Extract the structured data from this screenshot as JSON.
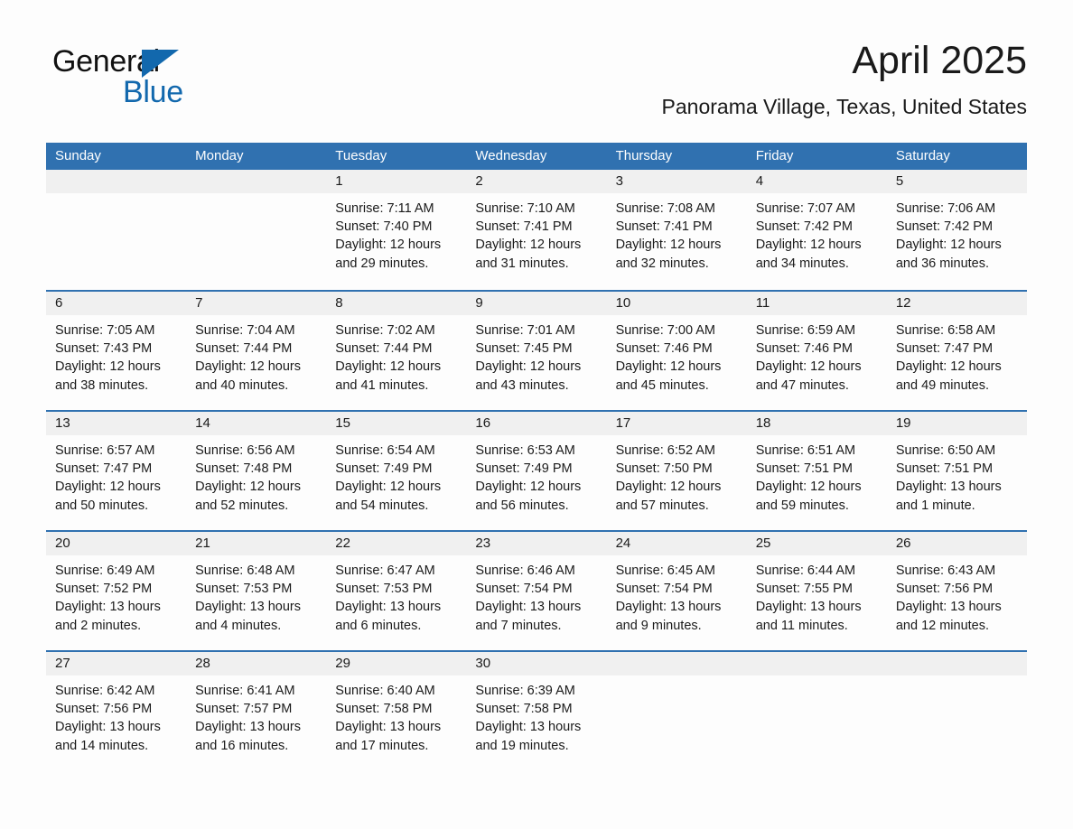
{
  "logo": {
    "word1": "General",
    "word2": "Blue",
    "triangle_color": "#1268ad"
  },
  "header": {
    "month_title": "April 2025",
    "location": "Panorama Village, Texas, United States"
  },
  "theme": {
    "header_blue": "#3071b0",
    "day_band_gray": "#f0f0f0",
    "page_background": "#fdfdfd",
    "text_color": "#1a1a1a"
  },
  "weekdays": [
    "Sunday",
    "Monday",
    "Tuesday",
    "Wednesday",
    "Thursday",
    "Friday",
    "Saturday"
  ],
  "weeks": [
    [
      {
        "day": "",
        "sunrise": "",
        "sunset": "",
        "daylight": "",
        "empty": true
      },
      {
        "day": "",
        "sunrise": "",
        "sunset": "",
        "daylight": "",
        "empty": true
      },
      {
        "day": "1",
        "sunrise": "Sunrise: 7:11 AM",
        "sunset": "Sunset: 7:40 PM",
        "daylight": "Daylight: 12 hours and 29 minutes."
      },
      {
        "day": "2",
        "sunrise": "Sunrise: 7:10 AM",
        "sunset": "Sunset: 7:41 PM",
        "daylight": "Daylight: 12 hours and 31 minutes."
      },
      {
        "day": "3",
        "sunrise": "Sunrise: 7:08 AM",
        "sunset": "Sunset: 7:41 PM",
        "daylight": "Daylight: 12 hours and 32 minutes."
      },
      {
        "day": "4",
        "sunrise": "Sunrise: 7:07 AM",
        "sunset": "Sunset: 7:42 PM",
        "daylight": "Daylight: 12 hours and 34 minutes."
      },
      {
        "day": "5",
        "sunrise": "Sunrise: 7:06 AM",
        "sunset": "Sunset: 7:42 PM",
        "daylight": "Daylight: 12 hours and 36 minutes."
      }
    ],
    [
      {
        "day": "6",
        "sunrise": "Sunrise: 7:05 AM",
        "sunset": "Sunset: 7:43 PM",
        "daylight": "Daylight: 12 hours and 38 minutes."
      },
      {
        "day": "7",
        "sunrise": "Sunrise: 7:04 AM",
        "sunset": "Sunset: 7:44 PM",
        "daylight": "Daylight: 12 hours and 40 minutes."
      },
      {
        "day": "8",
        "sunrise": "Sunrise: 7:02 AM",
        "sunset": "Sunset: 7:44 PM",
        "daylight": "Daylight: 12 hours and 41 minutes."
      },
      {
        "day": "9",
        "sunrise": "Sunrise: 7:01 AM",
        "sunset": "Sunset: 7:45 PM",
        "daylight": "Daylight: 12 hours and 43 minutes."
      },
      {
        "day": "10",
        "sunrise": "Sunrise: 7:00 AM",
        "sunset": "Sunset: 7:46 PM",
        "daylight": "Daylight: 12 hours and 45 minutes."
      },
      {
        "day": "11",
        "sunrise": "Sunrise: 6:59 AM",
        "sunset": "Sunset: 7:46 PM",
        "daylight": "Daylight: 12 hours and 47 minutes."
      },
      {
        "day": "12",
        "sunrise": "Sunrise: 6:58 AM",
        "sunset": "Sunset: 7:47 PM",
        "daylight": "Daylight: 12 hours and 49 minutes."
      }
    ],
    [
      {
        "day": "13",
        "sunrise": "Sunrise: 6:57 AM",
        "sunset": "Sunset: 7:47 PM",
        "daylight": "Daylight: 12 hours and 50 minutes."
      },
      {
        "day": "14",
        "sunrise": "Sunrise: 6:56 AM",
        "sunset": "Sunset: 7:48 PM",
        "daylight": "Daylight: 12 hours and 52 minutes."
      },
      {
        "day": "15",
        "sunrise": "Sunrise: 6:54 AM",
        "sunset": "Sunset: 7:49 PM",
        "daylight": "Daylight: 12 hours and 54 minutes."
      },
      {
        "day": "16",
        "sunrise": "Sunrise: 6:53 AM",
        "sunset": "Sunset: 7:49 PM",
        "daylight": "Daylight: 12 hours and 56 minutes."
      },
      {
        "day": "17",
        "sunrise": "Sunrise: 6:52 AM",
        "sunset": "Sunset: 7:50 PM",
        "daylight": "Daylight: 12 hours and 57 minutes."
      },
      {
        "day": "18",
        "sunrise": "Sunrise: 6:51 AM",
        "sunset": "Sunset: 7:51 PM",
        "daylight": "Daylight: 12 hours and 59 minutes."
      },
      {
        "day": "19",
        "sunrise": "Sunrise: 6:50 AM",
        "sunset": "Sunset: 7:51 PM",
        "daylight": "Daylight: 13 hours and 1 minute."
      }
    ],
    [
      {
        "day": "20",
        "sunrise": "Sunrise: 6:49 AM",
        "sunset": "Sunset: 7:52 PM",
        "daylight": "Daylight: 13 hours and 2 minutes."
      },
      {
        "day": "21",
        "sunrise": "Sunrise: 6:48 AM",
        "sunset": "Sunset: 7:53 PM",
        "daylight": "Daylight: 13 hours and 4 minutes."
      },
      {
        "day": "22",
        "sunrise": "Sunrise: 6:47 AM",
        "sunset": "Sunset: 7:53 PM",
        "daylight": "Daylight: 13 hours and 6 minutes."
      },
      {
        "day": "23",
        "sunrise": "Sunrise: 6:46 AM",
        "sunset": "Sunset: 7:54 PM",
        "daylight": "Daylight: 13 hours and 7 minutes."
      },
      {
        "day": "24",
        "sunrise": "Sunrise: 6:45 AM",
        "sunset": "Sunset: 7:54 PM",
        "daylight": "Daylight: 13 hours and 9 minutes."
      },
      {
        "day": "25",
        "sunrise": "Sunrise: 6:44 AM",
        "sunset": "Sunset: 7:55 PM",
        "daylight": "Daylight: 13 hours and 11 minutes."
      },
      {
        "day": "26",
        "sunrise": "Sunrise: 6:43 AM",
        "sunset": "Sunset: 7:56 PM",
        "daylight": "Daylight: 13 hours and 12 minutes."
      }
    ],
    [
      {
        "day": "27",
        "sunrise": "Sunrise: 6:42 AM",
        "sunset": "Sunset: 7:56 PM",
        "daylight": "Daylight: 13 hours and 14 minutes."
      },
      {
        "day": "28",
        "sunrise": "Sunrise: 6:41 AM",
        "sunset": "Sunset: 7:57 PM",
        "daylight": "Daylight: 13 hours and 16 minutes."
      },
      {
        "day": "29",
        "sunrise": "Sunrise: 6:40 AM",
        "sunset": "Sunset: 7:58 PM",
        "daylight": "Daylight: 13 hours and 17 minutes."
      },
      {
        "day": "30",
        "sunrise": "Sunrise: 6:39 AM",
        "sunset": "Sunset: 7:58 PM",
        "daylight": "Daylight: 13 hours and 19 minutes."
      },
      {
        "day": "",
        "sunrise": "",
        "sunset": "",
        "daylight": "",
        "empty": true
      },
      {
        "day": "",
        "sunrise": "",
        "sunset": "",
        "daylight": "",
        "empty": true
      },
      {
        "day": "",
        "sunrise": "",
        "sunset": "",
        "daylight": "",
        "empty": true
      }
    ]
  ]
}
